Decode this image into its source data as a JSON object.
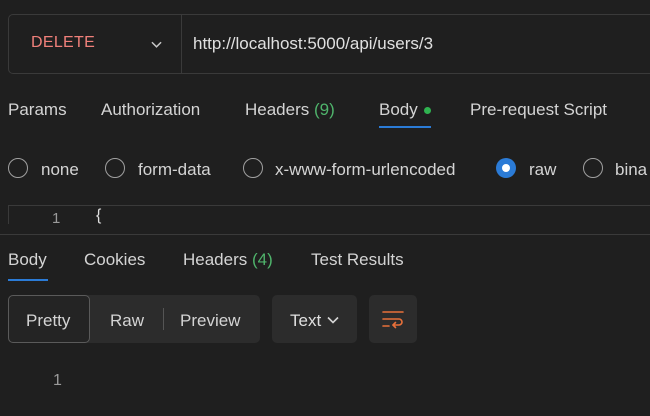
{
  "request": {
    "method": "DELETE",
    "url": "http://localhost:5000/api/users/3"
  },
  "request_tabs": {
    "params": "Params",
    "authorization": "Authorization",
    "headers": "Headers",
    "headers_count": "(9)",
    "body": "Body",
    "prerequest": "Pre-request Script",
    "active": "Body"
  },
  "body_types": {
    "none": "none",
    "form_data": "form-data",
    "urlencoded": "x-www-form-urlencoded",
    "raw": "raw",
    "binary": "bina",
    "selected": "raw"
  },
  "editor": {
    "line_number": "1",
    "content": "{"
  },
  "response_tabs": {
    "body": "Body",
    "cookies": "Cookies",
    "headers": "Headers",
    "headers_count": "(4)",
    "test_results": "Test Results",
    "active": "Body"
  },
  "view_modes": {
    "pretty": "Pretty",
    "raw": "Raw",
    "preview": "Preview",
    "selected": "Pretty"
  },
  "format": {
    "label": "Text",
    "icon": "chevron-down-icon"
  },
  "wrap": {
    "icon": "wrap-lines-icon",
    "color": "#e8703a"
  },
  "response_editor": {
    "line_number": "1"
  },
  "colors": {
    "method": "#f0807a",
    "accent": "#2b7bd6",
    "count": "#4fb36b",
    "dot": "#2fb350"
  }
}
